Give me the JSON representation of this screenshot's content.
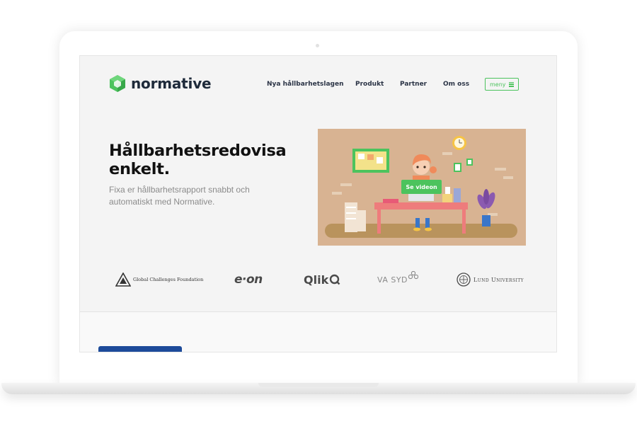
{
  "brand": {
    "name": "normative",
    "accent": "#4cc35d",
    "dark": "#1e2a3a"
  },
  "nav": {
    "items": [
      "Nya hållbarhetslagen",
      "Produkt",
      "Partner",
      "Om oss"
    ],
    "menu_label": "meny"
  },
  "hero": {
    "title_line1": "Hållbarhetsredovisa",
    "title_line2": "enkelt.",
    "subtitle_line1": "Fixa er hållbarhetsrapport snabbt och",
    "subtitle_line2": "automatiskt med Normative.",
    "video_button": "Se videon",
    "video_bg": "#d8b392"
  },
  "partners": {
    "gcf": "Global Challenges Foundation",
    "eon": "e·on",
    "qlik": "Qlik",
    "vasyd": "VA SYD",
    "lund": "Lund University"
  },
  "icons": [
    "logo-hexagon-icon",
    "hamburger-icon",
    "play-icon"
  ]
}
